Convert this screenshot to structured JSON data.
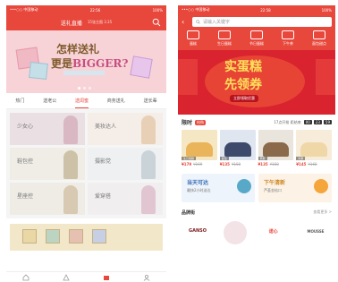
{
  "colors": {
    "accent": "#e8473b",
    "banner_red": "#d9232f",
    "yellow": "#ffe15a"
  },
  "left": {
    "status": {
      "carrier": "•••○○ 中国移动",
      "time": "22:56",
      "battery": "100%"
    },
    "header": {
      "title": "送礼直播",
      "subtitle": "15张主图 3.35",
      "search_icon": "search-icon"
    },
    "banner": {
      "line1": "怎样送礼",
      "line2_a": "更是",
      "line2_b": "BIGGER?"
    },
    "tabs": [
      "热门",
      "送老公",
      "送闺蜜",
      "商务送礼",
      "送长辈"
    ],
    "active_tab": 2,
    "grid": [
      {
        "label": "少女心"
      },
      {
        "label": "美妆达人"
      },
      {
        "label": "鞋包控"
      },
      {
        "label": "摄影党"
      },
      {
        "label": "星座控"
      },
      {
        "label": "爱穿搭"
      }
    ],
    "bottom_icons": [
      "home-icon",
      "category-icon",
      "gift-icon",
      "profile-icon"
    ]
  },
  "right": {
    "status": {
      "carrier": "•••○○ 中国移动",
      "time": "22:58",
      "battery": "100%"
    },
    "search": {
      "placeholder": "请输入关键字"
    },
    "categories": [
      "蛋糕",
      "生日蛋糕",
      "节日蛋糕",
      "下午茶",
      "面包甜点"
    ],
    "banner": {
      "line1": "实蛋糕",
      "line2": "先领券",
      "button": "立即领取优惠"
    },
    "flash": {
      "label": "限时",
      "hot": "抢购",
      "info": "17点开抢 距结束",
      "timer": [
        "00",
        "23",
        "59"
      ]
    },
    "products": [
      {
        "tag": "生日蛋糕",
        "price": "¥179",
        "old": "¥199"
      },
      {
        "tag": "蓝莓",
        "price": "¥135",
        "old": "¥158"
      },
      {
        "tag": "慕斯",
        "price": "¥135",
        "old": "¥158"
      },
      {
        "tag": "水果",
        "price": "¥145",
        "old": "¥168"
      }
    ],
    "ads": [
      {
        "title": "当天可达",
        "sub": "最快2小时送达"
      },
      {
        "title": "下午清新",
        "sub": "芦荟金桔口"
      }
    ],
    "brand": {
      "label": "品牌街",
      "more": "查看更多 >",
      "logos": [
        "GANSO",
        "",
        "诺心",
        "MOUSSE"
      ]
    }
  }
}
